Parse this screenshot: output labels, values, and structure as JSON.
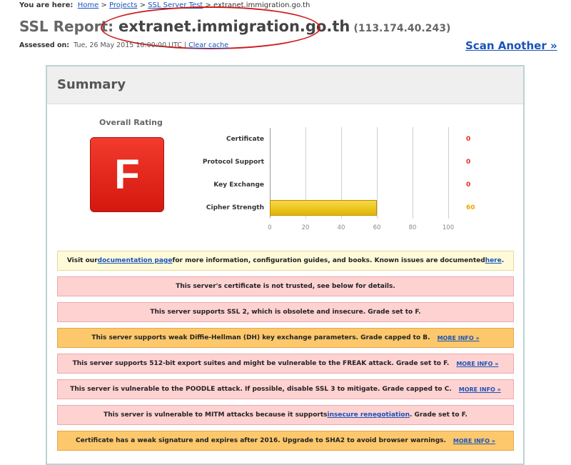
{
  "breadcrumb": {
    "label": "You are here:",
    "home": "Home",
    "sep1": " > ",
    "projects": "Projects",
    "sep2": " > ",
    "ssl_test": "SSL Server Test",
    "sep3": " > ",
    "current": "extranet.immigration.go.th"
  },
  "header": {
    "title_prefix": "SSL Report: ",
    "hostname": "extranet.immigration.go.th",
    "ip": "(113.174.40.243)",
    "assessed_label": "Assessed on:",
    "assessed_value": "Tue, 26 May 2015 10:00:00 UTC | ",
    "clear_cache": "Clear cache",
    "scan_another": "Scan Another »"
  },
  "summary": {
    "title": "Summary",
    "overall_rating_label": "Overall Rating",
    "grade": "F",
    "grade_color": "#e8281d",
    "colors": {
      "zero_value": "#e8281d",
      "cipher_value": "#f0a500",
      "bar": "#edc21a"
    }
  },
  "chart_data": {
    "type": "bar",
    "orientation": "horizontal",
    "categories": [
      "Certificate",
      "Protocol Support",
      "Key Exchange",
      "Cipher Strength"
    ],
    "values": [
      0,
      0,
      0,
      60
    ],
    "xlim": [
      0,
      100
    ],
    "ticks": [
      "0",
      "20",
      "40",
      "60",
      "80",
      "100"
    ],
    "grid": true
  },
  "messages": [
    {
      "type": "info",
      "pre": "Visit our ",
      "link": "documentation page",
      "mid": " for more information, configuration guides, and books. Known issues are documented ",
      "link2": "here",
      "post": "."
    },
    {
      "type": "error",
      "text": "This server's certificate is not trusted, see below for details."
    },
    {
      "type": "error",
      "text": "This server supports SSL 2, which is obsolete and insecure. Grade set to F."
    },
    {
      "type": "warning",
      "text": "This server supports weak Diffie-Hellman (DH) key exchange parameters. Grade capped to B.",
      "more": "MORE INFO »"
    },
    {
      "type": "error",
      "text": "This server supports 512-bit export suites and might be vulnerable to the FREAK attack. Grade set to F.",
      "more": "MORE INFO »"
    },
    {
      "type": "error",
      "text": "This server is vulnerable to the POODLE attack. If possible, disable SSL 3 to mitigate. Grade capped to C.",
      "more": "MORE INFO »"
    },
    {
      "type": "error",
      "pre": "This server is vulnerable to MITM attacks because it supports ",
      "link": "insecure renegotiation",
      "post": ". Grade set to F."
    },
    {
      "type": "warning",
      "text": "Certificate has a weak signature and expires after 2016. Upgrade to SHA2 to avoid browser warnings.",
      "more": "MORE INFO »"
    }
  ]
}
